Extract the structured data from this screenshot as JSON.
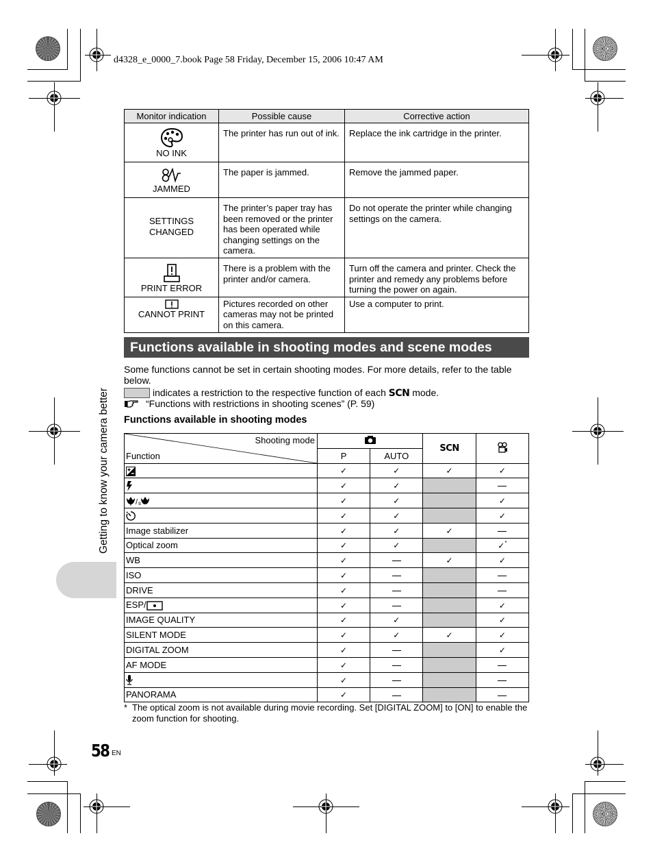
{
  "header": {
    "book_info": "d4328_e_0000_7.book  Page 58  Friday, December 15, 2006  10:47 AM"
  },
  "error_table": {
    "columns": [
      "Monitor indication",
      "Possible cause",
      "Corrective action"
    ],
    "rows": [
      {
        "icon": "no-ink-palette-icon",
        "indication": "NO INK",
        "cause": "The printer has run out of ink.",
        "action": "Replace the ink cartridge in the printer."
      },
      {
        "icon": "paper-jam-icon",
        "indication": "JAMMED",
        "cause": "The paper is jammed.",
        "action": "Remove the jammed paper."
      },
      {
        "icon": "",
        "indication": "SETTINGS CHANGED",
        "cause": "The printer’s paper tray has been removed or the printer has been operated while changing settings on the camera.",
        "action": "Do not operate the printer while changing settings on the camera."
      },
      {
        "icon": "print-error-icon",
        "indication": "PRINT ERROR",
        "cause": "There is a problem with the printer and/or camera.",
        "action": "Turn off the camera and printer. Check the printer and remedy any problems before turning the power on again."
      },
      {
        "icon": "cannot-print-icon",
        "indication": "CANNOT PRINT",
        "cause": "Pictures recorded on other cameras may not be printed on this camera.",
        "action": "Use a computer to print."
      }
    ]
  },
  "section": {
    "title": "Functions available in shooting modes and scene modes",
    "intro": "Some functions cannot be set in certain shooting modes. For more details, refer to the table below.",
    "legend_text_before": "indicates a restriction to the respective function of each",
    "legend_scn": "SCN",
    "legend_text_after": "mode.",
    "reference": "“Functions with restrictions in shooting scenes” (P. 59)",
    "subheading": "Functions available in shooting modes"
  },
  "functions_table": {
    "header_shooting_mode": "Shooting mode",
    "header_function": "Function",
    "col_camera_icon": "camera-icon",
    "col_p": "P",
    "col_auto": "AUTO",
    "col_scn": "SCN",
    "col_movie_icon": "movie-icon",
    "check_symbol": "✓",
    "shaded_color": "#cccccc",
    "rows": [
      {
        "name": "",
        "icon": "exposure-compensation-icon",
        "p": "check",
        "auto": "check",
        "scn": "check",
        "movie": "check"
      },
      {
        "name": "",
        "icon": "flash-icon",
        "p": "check",
        "auto": "check",
        "scn": "restricted",
        "movie": "dash"
      },
      {
        "name": "",
        "icon": "macro-supermacro-icon",
        "p": "check",
        "auto": "check",
        "scn": "restricted",
        "movie": "check"
      },
      {
        "name": "",
        "icon": "self-timer-icon",
        "p": "check",
        "auto": "check",
        "scn": "restricted",
        "movie": "check"
      },
      {
        "name": "Image stabilizer",
        "icon": "",
        "p": "check",
        "auto": "check",
        "scn": "check",
        "movie": "dash"
      },
      {
        "name": "Optical zoom",
        "icon": "",
        "p": "check",
        "auto": "check",
        "scn": "restricted",
        "movie": "check*"
      },
      {
        "name": "WB",
        "icon": "",
        "p": "check",
        "auto": "dash",
        "scn": "check",
        "movie": "check"
      },
      {
        "name": "ISO",
        "icon": "",
        "p": "check",
        "auto": "dash",
        "scn": "restricted",
        "movie": "dash"
      },
      {
        "name": "DRIVE",
        "icon": "",
        "p": "check",
        "auto": "dash",
        "scn": "restricted",
        "movie": "dash"
      },
      {
        "name": "ESP/",
        "icon": "spot-metering-icon",
        "p": "check",
        "auto": "dash",
        "scn": "restricted",
        "movie": "check"
      },
      {
        "name": "IMAGE QUALITY",
        "icon": "",
        "p": "check",
        "auto": "check",
        "scn": "restricted",
        "movie": "check"
      },
      {
        "name": "SILENT MODE",
        "icon": "",
        "p": "check",
        "auto": "check",
        "scn": "check",
        "movie": "check"
      },
      {
        "name": "DIGITAL ZOOM",
        "icon": "",
        "p": "check",
        "auto": "dash",
        "scn": "restricted",
        "movie": "check"
      },
      {
        "name": "AF MODE",
        "icon": "",
        "p": "check",
        "auto": "dash",
        "scn": "restricted",
        "movie": "dash"
      },
      {
        "name": "",
        "icon": "microphone-icon",
        "p": "check",
        "auto": "dash",
        "scn": "restricted",
        "movie": "dash"
      },
      {
        "name": "PANORAMA",
        "icon": "",
        "p": "check",
        "auto": "dash",
        "scn": "restricted",
        "movie": "dash"
      }
    ],
    "footnote_marker": "*",
    "footnote": "The optical zoom is not available during movie recording. Set [DIGITAL ZOOM] to [ON] to enable the zoom function for shooting."
  },
  "side_tab": {
    "label": "Getting to know your camera better"
  },
  "footer": {
    "page_number": "58",
    "language": "EN"
  }
}
